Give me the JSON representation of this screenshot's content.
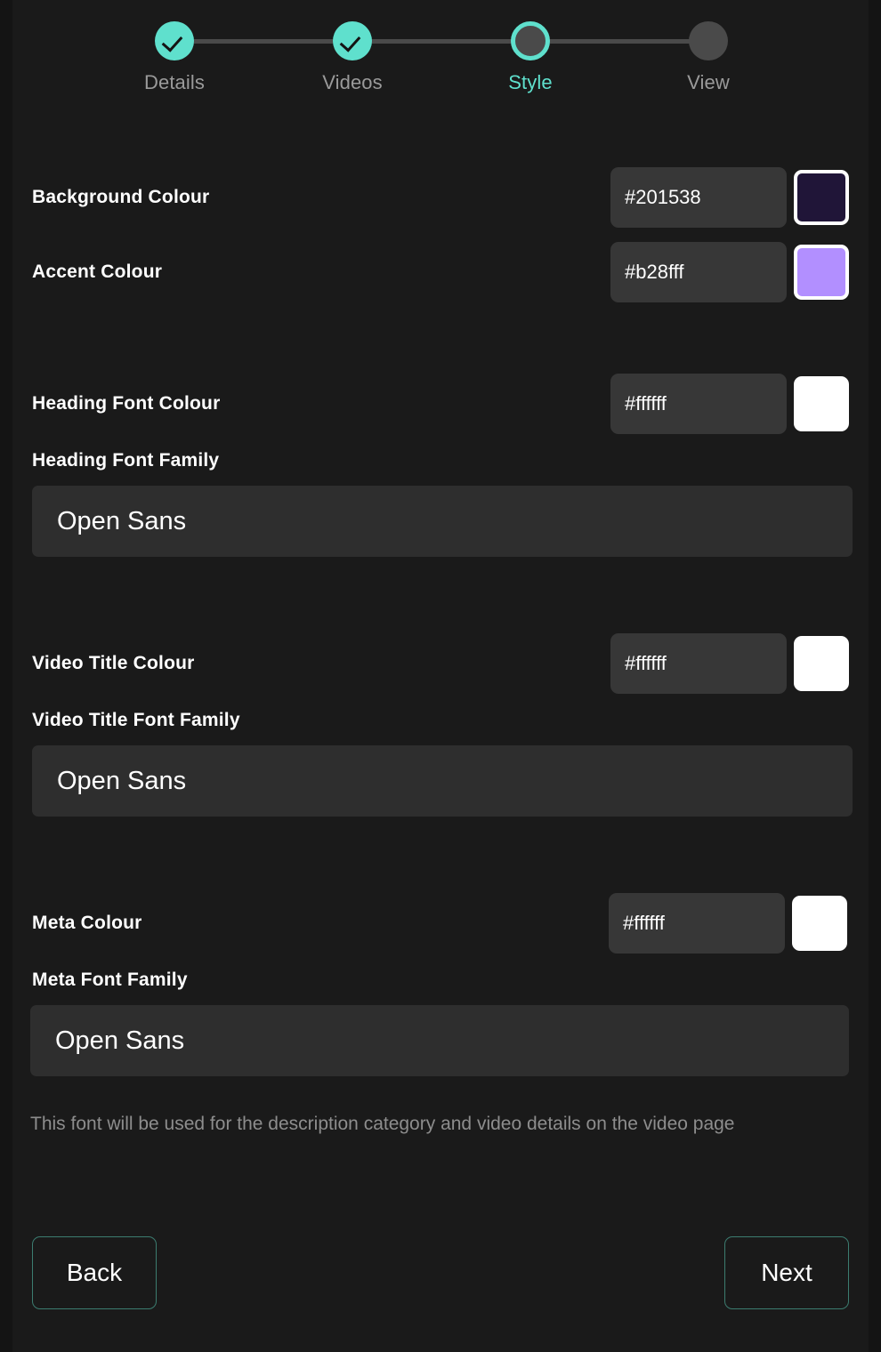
{
  "stepper": {
    "steps": [
      {
        "label": "Details",
        "state": "done"
      },
      {
        "label": "Videos",
        "state": "done"
      },
      {
        "label": "Style",
        "state": "active"
      },
      {
        "label": "View",
        "state": "todo"
      }
    ],
    "active_color": "#5fe0cd",
    "inactive_color": "#4a4a4a",
    "label_color": "#9a9a9a"
  },
  "form": {
    "background_colour": {
      "label": "Background Colour",
      "value": "#201538",
      "swatch": "#201538"
    },
    "accent_colour": {
      "label": "Accent Colour",
      "value": "#b28fff",
      "swatch": "#b28fff"
    },
    "heading_font_colour": {
      "label": "Heading Font Colour",
      "value": "#ffffff",
      "swatch": "#ffffff"
    },
    "heading_font_family": {
      "label": "Heading Font Family",
      "value": "Open Sans"
    },
    "video_title_colour": {
      "label": "Video Title Colour",
      "value": "#ffffff",
      "swatch": "#ffffff"
    },
    "video_title_font_family": {
      "label": "Video Title Font Family",
      "value": "Open Sans"
    },
    "meta_colour": {
      "label": "Meta Colour",
      "value": "#ffffff",
      "swatch": "#ffffff"
    },
    "meta_font_family": {
      "label": "Meta Font Family",
      "value": "Open Sans"
    },
    "meta_helper_text": "This font will be used for the description category and video details on the video page"
  },
  "footer": {
    "back_label": "Back",
    "next_label": "Next",
    "border_color": "#3c7c70"
  }
}
